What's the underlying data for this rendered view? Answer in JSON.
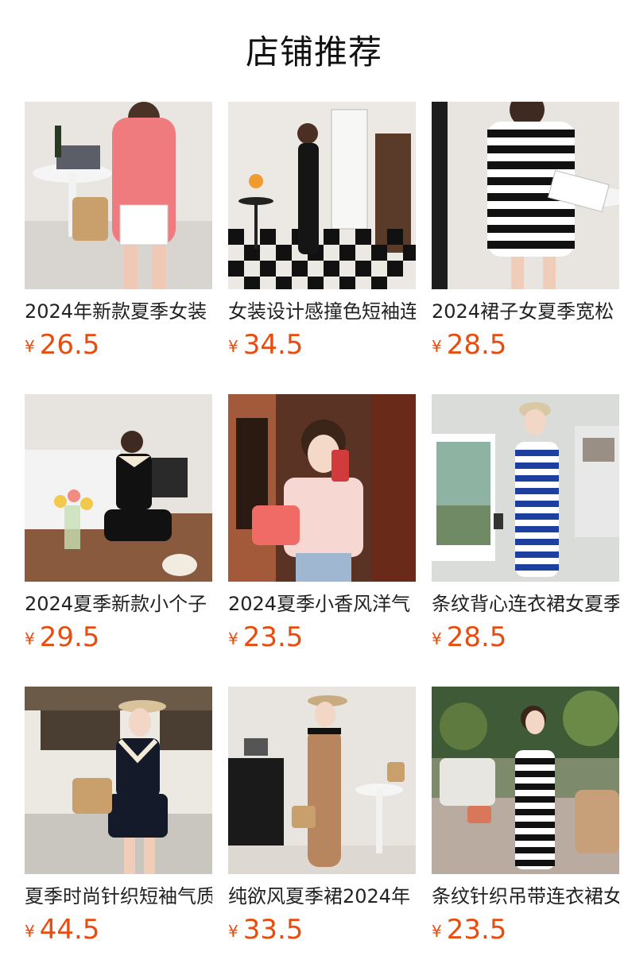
{
  "page": {
    "title": "店铺推荐"
  },
  "products": [
    {
      "name": "2024年新款夏季女装",
      "currency": "¥",
      "price": "26.5",
      "image": "woman-in-pink-knit-dress"
    },
    {
      "name": "女装设计感撞色短袖连衣裙",
      "currency": "¥",
      "price": "34.5",
      "image": "woman-in-black-polo-dress"
    },
    {
      "name": "2024裙子女夏季宽松",
      "currency": "¥",
      "price": "28.5",
      "image": "woman-in-striped-tee-dress"
    },
    {
      "name": "2024夏季新款小个子",
      "currency": "¥",
      "price": "29.5",
      "image": "woman-in-black-collar-dress"
    },
    {
      "name": "2024夏季小香风洋气",
      "currency": "¥",
      "price": "23.5",
      "image": "woman-in-pink-cardigan"
    },
    {
      "name": "条纹背心连衣裙女夏季",
      "currency": "¥",
      "price": "28.5",
      "image": "woman-in-blue-striped-dress"
    },
    {
      "name": "夏季时尚针织短袖气质",
      "currency": "¥",
      "price": "44.5",
      "image": "woman-in-navy-knit-set"
    },
    {
      "name": "纯欲风夏季裙2024年",
      "currency": "¥",
      "price": "33.5",
      "image": "woman-in-camel-knit-dress"
    },
    {
      "name": "条纹针织吊带连衣裙女",
      "currency": "¥",
      "price": "23.5",
      "image": "woman-in-striped-slip-dress"
    }
  ],
  "colors": {
    "price": "#e84c0f",
    "text": "#222222"
  }
}
